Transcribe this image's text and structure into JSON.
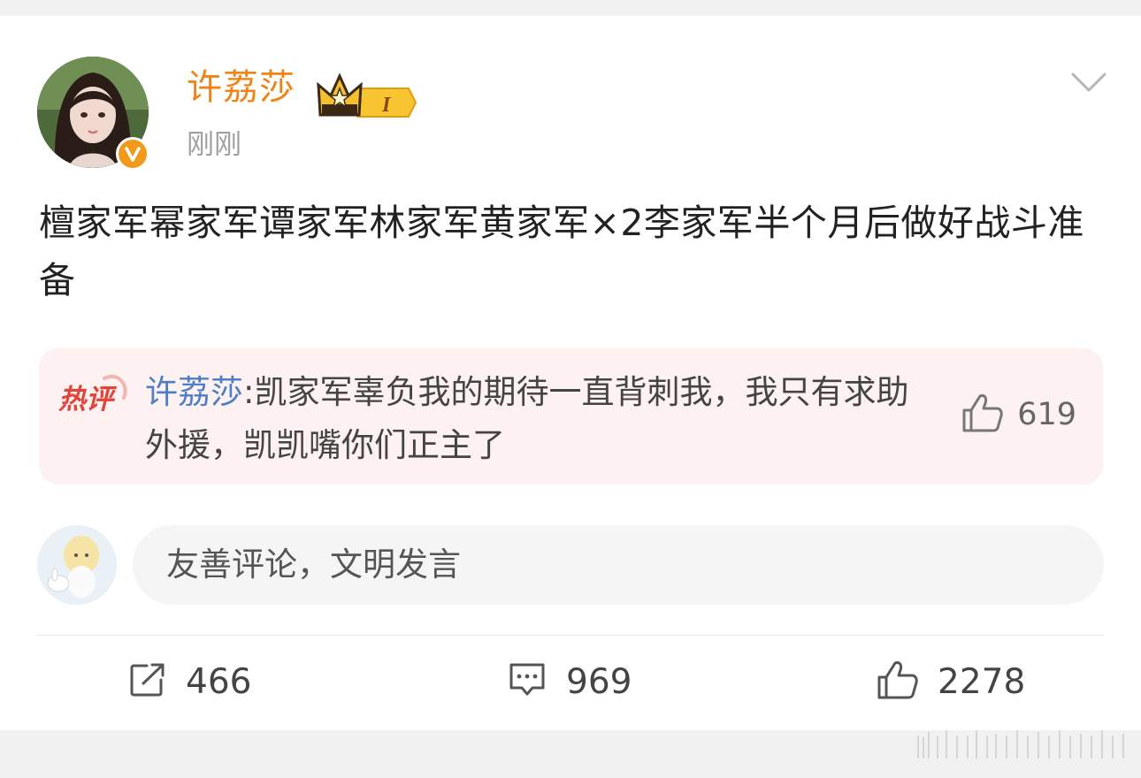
{
  "post": {
    "author": "许荔莎",
    "time": "刚刚",
    "text": "檀家军幂家军谭家军林家军黄家军×2李家军半个月后做好战斗准备"
  },
  "hot_comment": {
    "tag": "热评",
    "author": "许荔莎",
    "separator": ":",
    "text": "凯家军辜负我的期待一直背刺我，我只有求助外援，凯凯嘴你们正主了",
    "likes": "619"
  },
  "comment_input": {
    "placeholder": "友善评论，文明发言"
  },
  "actions": {
    "reposts": "466",
    "comments": "969",
    "likes": "2278"
  },
  "icons": {
    "verified": "verified-v-icon",
    "member": "crown-member-badge-icon",
    "menu": "chevron-down-icon",
    "repost": "repost-icon",
    "comment": "comment-icon",
    "like": "thumbs-up-icon"
  },
  "colors": {
    "username": "#f08418",
    "comment_author": "#4d7ec6",
    "hot_tag": "#e2443a",
    "verified": "#f29a1b"
  }
}
